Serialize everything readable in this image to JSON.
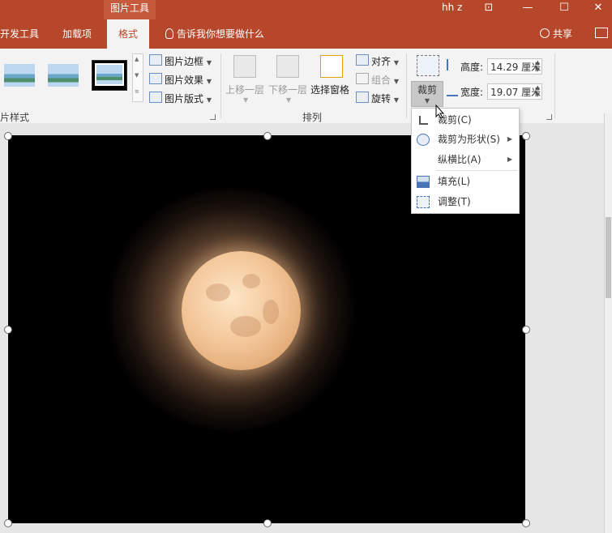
{
  "titlebar": {
    "context_tab": "图片工具",
    "user": "hh z",
    "controls": [
      "⊡",
      "—",
      "☐",
      "✕"
    ]
  },
  "tabs": [
    {
      "label": "开发工具"
    },
    {
      "label": "加载项"
    },
    {
      "label": "格式",
      "active": true
    }
  ],
  "tellme": "告诉我你想要做什么",
  "share": "共享",
  "ribbon": {
    "picture_styles_label": "片样式",
    "picture_border": "图片边框",
    "picture_effects": "图片效果",
    "picture_layout": "图片版式",
    "bring_forward": "上移一层",
    "send_backward": "下移一层",
    "selection_pane": "选择窗格",
    "align": "对齐",
    "group": "组合",
    "rotate": "旋转",
    "arrange_label": "排列",
    "crop": "裁剪",
    "height_label": "高度:",
    "height_value": "14.29 厘米",
    "width_label": "宽度:",
    "width_value": "19.07 厘米"
  },
  "crop_menu": [
    {
      "label": "裁剪(C)",
      "icon": "crop-icon"
    },
    {
      "label": "裁剪为形状(S)",
      "icon": "shape-icon",
      "submenu": true
    },
    {
      "label": "纵横比(A)",
      "icon": "",
      "submenu": true
    },
    {
      "label": "填充(L)",
      "icon": "fill-icon"
    },
    {
      "label": "调整(T)",
      "icon": "fit-icon"
    }
  ],
  "colors": {
    "accent": "#b7472a",
    "ribbon_bg": "#f3f3f3"
  }
}
